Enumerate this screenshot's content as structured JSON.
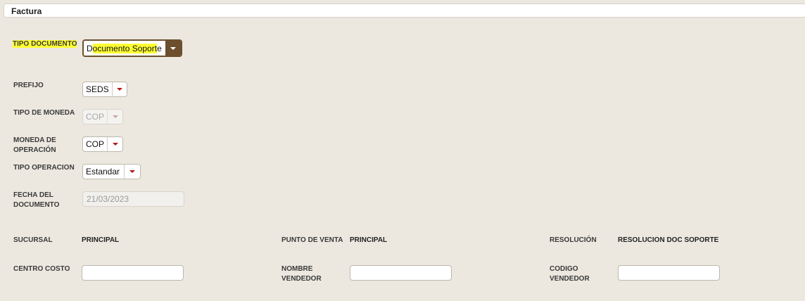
{
  "tab": {
    "title": "Factura"
  },
  "form": {
    "tipo_documento": {
      "label": "TIPO DOCUMENTO",
      "value_pre": "D",
      "value_hl": "ocumento Soport",
      "value_post": "e"
    },
    "prefijo": {
      "label": "PREFIJO",
      "value": "SEDS"
    },
    "tipo_moneda": {
      "label": "TIPO DE MONEDA",
      "value": "COP"
    },
    "moneda_operacion": {
      "label_line1": "MONEDA DE",
      "label_line2": "OPERACIÓN",
      "value": "COP"
    },
    "tipo_operacion": {
      "label": "TIPO OPERACION",
      "value": "Estandar"
    },
    "fecha_documento": {
      "label_line1": "FECHA DEL",
      "label_line2": "DOCUMENTO",
      "value": "21/03/2023"
    }
  },
  "info": {
    "sucursal": {
      "label": "SUCURSAL",
      "value": "PRINCIPAL"
    },
    "punto_venta": {
      "label": "PUNTO DE VENTA",
      "value": "PRINCIPAL"
    },
    "resolucion": {
      "label": "RESOLUCIÓN",
      "value": "RESOLUCION DOC SOPORTE"
    },
    "centro_costo": {
      "label": "CENTRO COSTO",
      "value": ""
    },
    "nombre_vendedor": {
      "label_line1": "NOMBRE",
      "label_line2": "VENDEDOR",
      "value": ""
    },
    "codigo_vendedor": {
      "label_line1": "CODIGO",
      "label_line2": "VENDEDOR",
      "value": ""
    }
  }
}
